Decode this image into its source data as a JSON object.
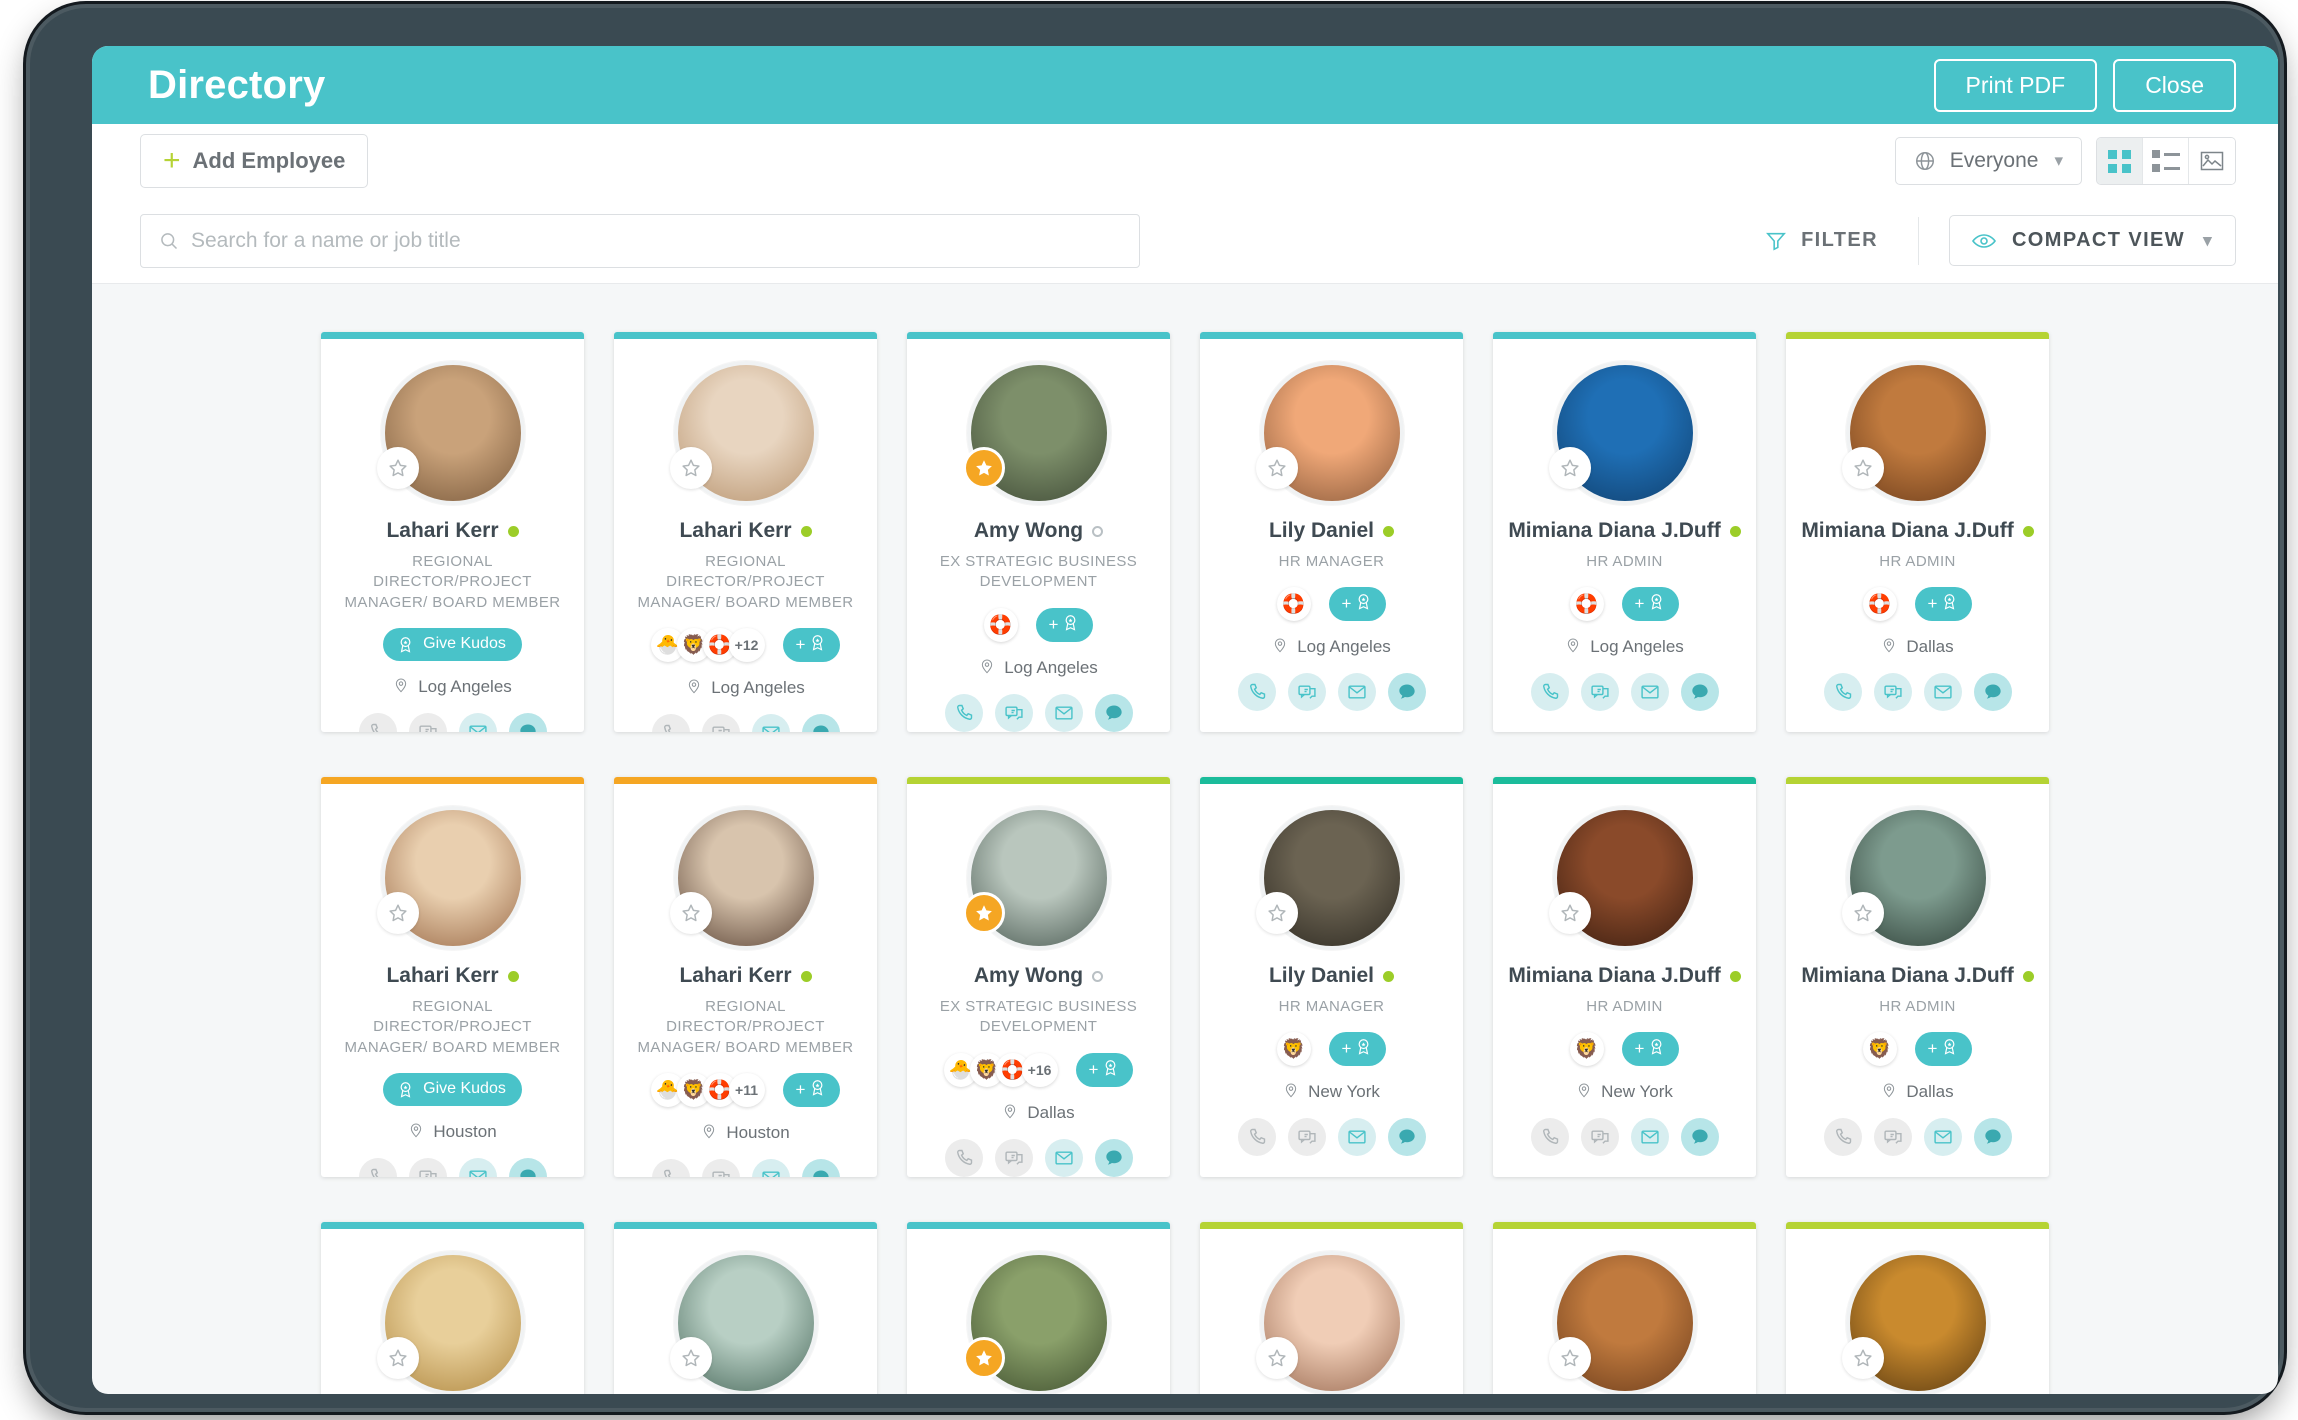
{
  "titlebar": {
    "title": "Directory",
    "print_label": "Print PDF",
    "close_label": "Close"
  },
  "toolbar": {
    "add_employee_label": "Add Employee",
    "audience_label": "Everyone",
    "view_modes": [
      "grid-view",
      "list-view",
      "photo-view"
    ],
    "active_view": "photo-view"
  },
  "search": {
    "placeholder": "Search for a name or job title",
    "value": ""
  },
  "filters": {
    "filter_label": "FILTER",
    "compact_view_label": "COMPACT VIEW"
  },
  "colors": {
    "accent": "#49c3c9",
    "green": "#9ccd28",
    "orange": "#f5a623",
    "teal_dark": "#1bbc9b",
    "bezel": "#3a4a52"
  },
  "cards": [
    {
      "name": "Lahari Kerr",
      "title": "REGIONAL DIRECTOR/PROJECT MANAGER/ BOARD MEMBER",
      "location": "Log Angeles",
      "top_color": "#49c3c9",
      "status": "online",
      "starred": false,
      "kudos_mode": "give",
      "kudos_label": "Give Kudos",
      "badges": [],
      "badge_more": "",
      "avatar_colors": [
        "#c9a27a",
        "#7a5a3c"
      ],
      "contacts": [
        "off",
        "off",
        "light",
        "solid"
      ]
    },
    {
      "name": "Lahari Kerr",
      "title": "REGIONAL DIRECTOR/PROJECT MANAGER/ BOARD MEMBER",
      "location": "Log Angeles",
      "top_color": "#49c3c9",
      "status": "online",
      "starred": false,
      "kudos_mode": "badges",
      "kudos_label": "",
      "badges": [
        "🐣",
        "🦁",
        "🛟"
      ],
      "badge_more": "+12",
      "avatar_colors": [
        "#e8d5c0",
        "#b8946f"
      ],
      "contacts": [
        "off",
        "off",
        "light",
        "solid"
      ]
    },
    {
      "name": "Amy Wong",
      "title": "EX STRATEGIC BUSINESS DEVELOPMENT",
      "location": "Log Angeles",
      "top_color": "#49c3c9",
      "status": "offline",
      "starred": true,
      "kudos_mode": "badges",
      "kudos_label": "",
      "badges": [
        "🛟"
      ],
      "badge_more": "",
      "avatar_colors": [
        "#7d8f6a",
        "#3f4a36"
      ],
      "contacts": [
        "light",
        "light",
        "light",
        "solid"
      ]
    },
    {
      "name": "Lily Daniel",
      "title": "HR MANAGER",
      "location": "Log Angeles",
      "top_color": "#49c3c9",
      "status": "online",
      "starred": false,
      "kudos_mode": "badges",
      "kudos_label": "",
      "badges": [
        "🛟"
      ],
      "badge_more": "",
      "avatar_colors": [
        "#f0a878",
        "#8a5a3a"
      ],
      "contacts": [
        "light",
        "light",
        "light",
        "solid"
      ]
    },
    {
      "name": "Mimiana Diana J.Duff",
      "title": "HR ADMIN",
      "location": "Log Angeles",
      "top_color": "#49c3c9",
      "status": "online",
      "starred": false,
      "kudos_mode": "badges",
      "kudos_label": "",
      "badges": [
        "🛟"
      ],
      "badge_more": "",
      "avatar_colors": [
        "#1f6fb5",
        "#10406e"
      ],
      "contacts": [
        "light",
        "light",
        "light",
        "solid"
      ]
    },
    {
      "name": "Mimiana Diana J.Duff",
      "title": "HR ADMIN",
      "location": "Dallas",
      "top_color": "#b5d334",
      "status": "online",
      "starred": false,
      "kudos_mode": "badges",
      "kudos_label": "",
      "badges": [
        "🛟"
      ],
      "badge_more": "",
      "avatar_colors": [
        "#c07a3e",
        "#6e3e1c"
      ],
      "contacts": [
        "light",
        "light",
        "light",
        "solid"
      ]
    },
    {
      "name": "Lahari Kerr",
      "title": "REGIONAL DIRECTOR/PROJECT MANAGER/ BOARD MEMBER",
      "location": "Houston",
      "top_color": "#f5a623",
      "status": "online",
      "starred": false,
      "kudos_mode": "give",
      "kudos_label": "Give Kudos",
      "badges": [],
      "badge_more": "",
      "avatar_colors": [
        "#e9cfaf",
        "#9b6b48"
      ],
      "contacts": [
        "off",
        "off",
        "light",
        "solid"
      ]
    },
    {
      "name": "Lahari Kerr",
      "title": "REGIONAL DIRECTOR/PROJECT MANAGER/ BOARD MEMBER",
      "location": "Houston",
      "top_color": "#f5a623",
      "status": "online",
      "starred": false,
      "kudos_mode": "badges",
      "kudos_label": "",
      "badges": [
        "🐣",
        "🦁",
        "🛟"
      ],
      "badge_more": "+11",
      "avatar_colors": [
        "#d8c4ad",
        "#5b4436"
      ],
      "contacts": [
        "off",
        "off",
        "light",
        "solid"
      ]
    },
    {
      "name": "Amy Wong",
      "title": "EX STRATEGIC BUSINESS DEVELOPMENT",
      "location": "Dallas",
      "top_color": "#b5d334",
      "status": "offline",
      "starred": true,
      "kudos_mode": "badges",
      "kudos_label": "",
      "badges": [
        "🐣",
        "🦁",
        "🛟"
      ],
      "badge_more": "+16",
      "avatar_colors": [
        "#b9c6bd",
        "#4a5a52"
      ],
      "contacts": [
        "off",
        "off",
        "light",
        "solid"
      ]
    },
    {
      "name": "Lily Daniel",
      "title": "HR MANAGER",
      "location": "New York",
      "top_color": "#1bbc9b",
      "status": "online",
      "starred": false,
      "kudos_mode": "badges",
      "kudos_label": "",
      "badges": [
        "🦁"
      ],
      "badge_more": "",
      "avatar_colors": [
        "#6b6352",
        "#2e2a22"
      ],
      "contacts": [
        "off",
        "off",
        "light",
        "solid"
      ]
    },
    {
      "name": "Mimiana Diana J.Duff",
      "title": "HR ADMIN",
      "location": "New York",
      "top_color": "#1bbc9b",
      "status": "online",
      "starred": false,
      "kudos_mode": "badges",
      "kudos_label": "",
      "badges": [
        "🦁"
      ],
      "badge_more": "",
      "avatar_colors": [
        "#8a4a2a",
        "#3a1d10"
      ],
      "contacts": [
        "off",
        "off",
        "light",
        "solid"
      ]
    },
    {
      "name": "Mimiana Diana J.Duff",
      "title": "HR ADMIN",
      "location": "Dallas",
      "top_color": "#b5d334",
      "status": "online",
      "starred": false,
      "kudos_mode": "badges",
      "kudos_label": "",
      "badges": [
        "🦁"
      ],
      "badge_more": "",
      "avatar_colors": [
        "#7d9b8e",
        "#2f4038"
      ],
      "contacts": [
        "off",
        "off",
        "light",
        "solid"
      ]
    }
  ],
  "partial_row": [
    {
      "top_color": "#49c3c9",
      "starred": false,
      "avatar_colors": [
        "#e8cf9a",
        "#b08840"
      ]
    },
    {
      "top_color": "#49c3c9",
      "starred": false,
      "avatar_colors": [
        "#b8cfc4",
        "#4a6a5c"
      ]
    },
    {
      "top_color": "#49c3c9",
      "starred": true,
      "avatar_colors": [
        "#8aa06a",
        "#3f4f2e"
      ]
    },
    {
      "top_color": "#b5d334",
      "starred": false,
      "avatar_colors": [
        "#f0cdb6",
        "#9a6b52"
      ]
    },
    {
      "top_color": "#b5d334",
      "starred": false,
      "avatar_colors": [
        "#c07a3e",
        "#6e3e1c"
      ]
    },
    {
      "top_color": "#b5d334",
      "starred": false,
      "avatar_colors": [
        "#c98a2e",
        "#5a3a10"
      ]
    }
  ]
}
